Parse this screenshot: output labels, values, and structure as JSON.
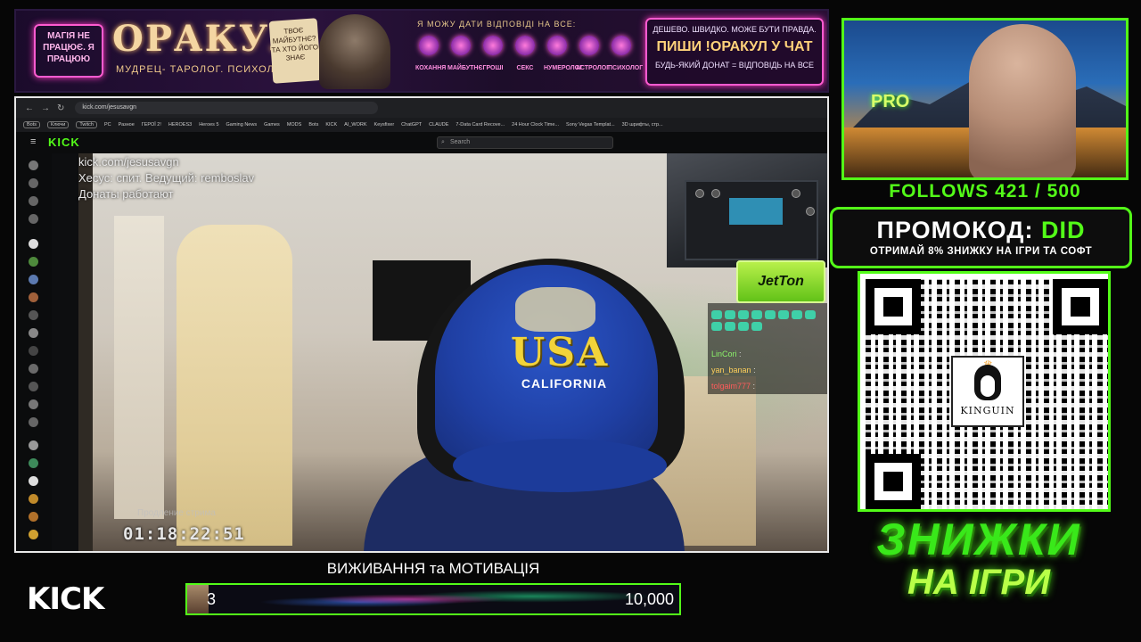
{
  "banner": {
    "tag": "МАГІЯ НЕ ПРАЦЮЄ. Я ПРАЦЮЮ",
    "title": "ОРАКУЛ",
    "subtitle": "МУДРЕЦ- ТАРОЛОГ. ПСИХОЛОГ.",
    "card_text": "ТВОЄ МАЙБУТНЄ? ТА ХТО ЙОГО ЗНАЄ",
    "ask_line": "Я МОЖУ ДАТИ ВІДПОВІДІ НА ВСЕ:",
    "topics": [
      "КОХАННЯ",
      "МАЙБУТНЄ",
      "ГРОШІ",
      "СЕКС",
      "НУМЕРОЛОГ",
      "АСТРОЛОГ",
      "ПСИХОЛОГ"
    ],
    "right_line1": "ДЕШЕВО. ШВИДКО. МОЖЕ БУТИ ПРАВДА.",
    "right_line2": "ПИШИ !ОРАКУЛ У ЧАТ",
    "right_line3": "БУДЬ-ЯКИЙ ДОНАТ = ВІДПОВІДЬ НА ВСЕ"
  },
  "browser": {
    "url": "kick.com/jesusavgn",
    "bookmarks": [
      "Bots",
      "Ключи",
      "Twitch",
      "PC",
      "Разное",
      "ГЕРОЇ 2!",
      "HEROES3",
      "Heroes 5",
      "Gaming News",
      "Games",
      "MODS",
      "Bots",
      "KICK",
      "AI_WORK",
      "Keysfixer",
      "ChatGPT",
      "CLAUDE",
      "7-Data Card Recove...",
      "24 Hour Clock Time...",
      "Sony Vegas Templat...",
      "3D шрифты, стр..."
    ],
    "kick_logo": "KICK",
    "search_placeholder": "Search"
  },
  "stream": {
    "overlay_line1": "kick.com/jesusavgn",
    "overlay_line2": "Хесус: спит. Ведущий: remboslav",
    "overlay_line3": "Донаты работают",
    "timer_label": "Продление стрима",
    "timer": "01:18:22:51",
    "cap_text1": "USA",
    "cap_text2": "CALIFORNIA",
    "sponsor": "JetTon",
    "chat": [
      {
        "user": "LinCori",
        "msg": ":"
      },
      {
        "user": "yan_banan",
        "msg": ":"
      },
      {
        "user": "tolgaim777",
        "msg": ":"
      }
    ]
  },
  "bottom": {
    "kick_logo": "KICK",
    "goal_title": "ВИЖИВАННЯ та МОТИВАЦІЯ",
    "goal_current": "3",
    "goal_target": "10,000"
  },
  "sidebar": {
    "follows": "FOLLOWS 421 / 500",
    "promo_label": "ПРОМОКОД:",
    "promo_code": "DID",
    "promo_sub": "ОТРИМАЙ 8% ЗНИЖКУ НА ІГРИ ТА СОФТ",
    "qr_brand": "KINGUIN",
    "discount_1": "ЗНИЖКИ",
    "discount_2": "НА ІГРИ",
    "cam_sign": "PRO"
  },
  "colors": {
    "kick_green": "#53fc18",
    "banner_pink": "#ff5bd0",
    "banner_gold": "#f4d6a2"
  }
}
